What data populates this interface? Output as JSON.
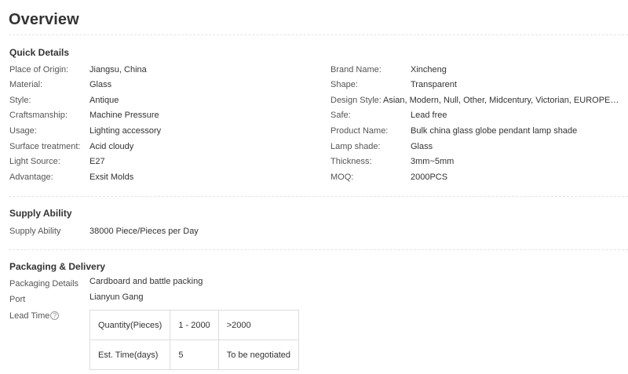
{
  "overview": {
    "title": "Overview"
  },
  "quick_details": {
    "title": "Quick Details",
    "left": [
      {
        "label": "Place of Origin:",
        "value": "Jiangsu, China"
      },
      {
        "label": "Material:",
        "value": "Glass"
      },
      {
        "label": "Style:",
        "value": "Antique"
      },
      {
        "label": "Craftsmanship:",
        "value": "Machine Pressure"
      },
      {
        "label": "Usage:",
        "value": "Lighting accessory"
      },
      {
        "label": "Surface treatment:",
        "value": "Acid cloudy"
      },
      {
        "label": "Light Source:",
        "value": "E27"
      },
      {
        "label": "Advantage:",
        "value": "Exsit Molds"
      }
    ],
    "right": [
      {
        "label": "Brand Name:",
        "value": "Xincheng"
      },
      {
        "label": "Shape:",
        "value": "Transparent"
      },
      {
        "label": "Design Style:",
        "value": "Asian, Modern, Null, Other, Midcentury, Victorian, EUROPEAN, Indust..."
      },
      {
        "label": "Safe:",
        "value": "Lead free"
      },
      {
        "label": "Product Name:",
        "value": "Bulk china glass globe pendant lamp shade"
      },
      {
        "label": "Lamp shade:",
        "value": "Glass"
      },
      {
        "label": "Thickness:",
        "value": "3mm~5mm"
      },
      {
        "label": "MOQ:",
        "value": "2000PCS"
      }
    ]
  },
  "supply_ability": {
    "title": "Supply Ability",
    "label": "Supply Ability",
    "value": "38000 Piece/Pieces per Day"
  },
  "packaging": {
    "title": "Packaging & Delivery",
    "details_label": "Packaging Details",
    "details_value": "Cardboard and battle packing",
    "port_label": "Port",
    "port_value": "Lianyun Gang",
    "lead_time_label": "Lead Time",
    "help_icon": "question-circle-icon",
    "help_glyph": "?",
    "lead_table": {
      "rows": [
        [
          "Quantity(Pieces)",
          "1 - 2000",
          ">2000"
        ],
        [
          "Est. Time(days)",
          "5",
          "To be negotiated"
        ]
      ]
    }
  }
}
